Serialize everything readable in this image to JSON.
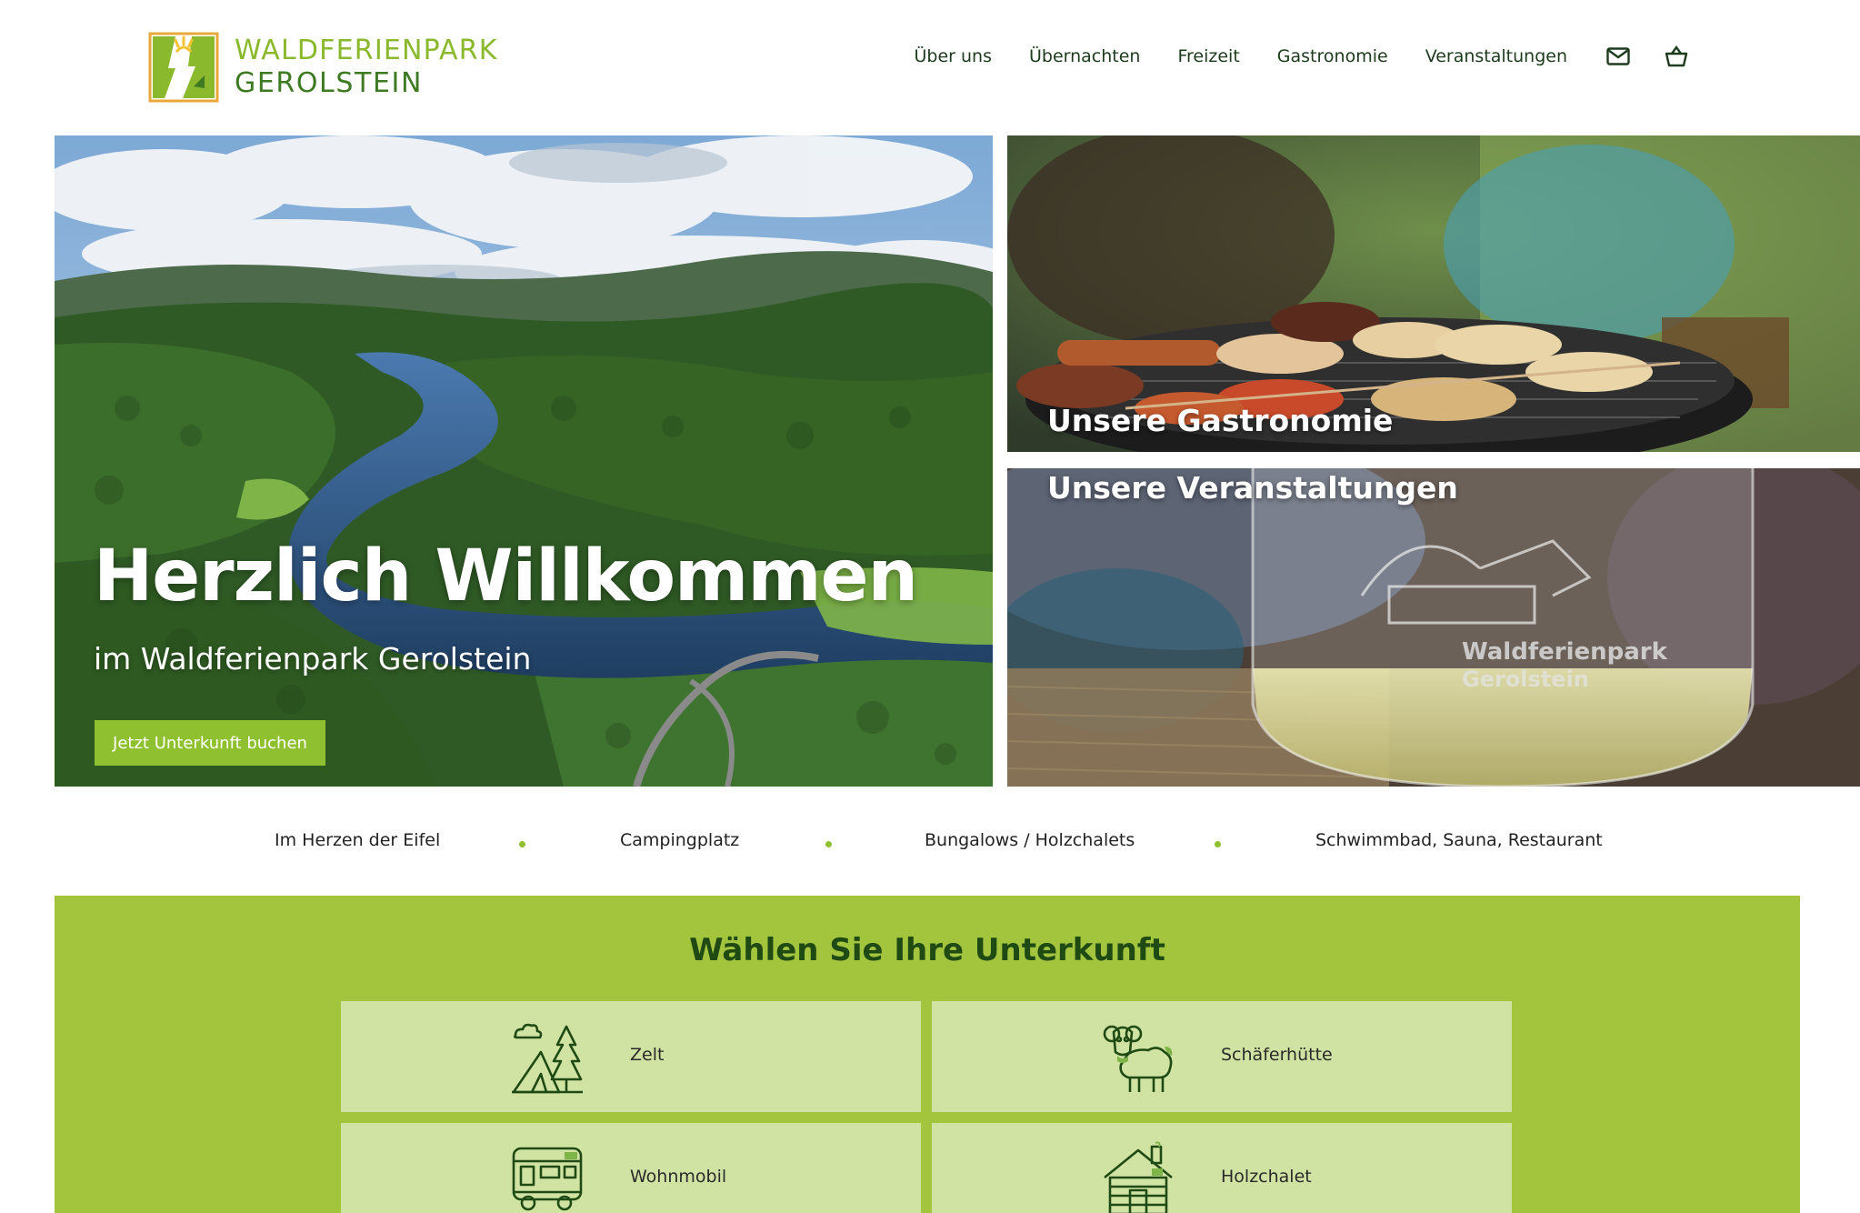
{
  "brand": {
    "name_line1": "WALDFERIENPARK",
    "name_line2": "GEROLSTEIN",
    "accent_color": "#8fc02f",
    "dark_green": "#1f4a14"
  },
  "nav": {
    "items": [
      {
        "label": "Über uns"
      },
      {
        "label": "Übernachten"
      },
      {
        "label": "Freizeit"
      },
      {
        "label": "Gastronomie"
      },
      {
        "label": "Veranstaltungen"
      }
    ],
    "icons": [
      "mail-icon",
      "cart-icon"
    ]
  },
  "hero": {
    "title": "Herzlich Willkommen",
    "subtitle": "im Waldferienpark Gerolstein",
    "cta_label": "Jetzt Unterkunft buchen"
  },
  "tiles": {
    "gastronomy": {
      "title": "Unsere Gastronomie"
    },
    "events": {
      "title": "Unsere Veranstaltungen",
      "glass_text_1": "Waldferienpark",
      "glass_text_2": "Gerolstein"
    }
  },
  "features": [
    "Im Herzen der Eifel",
    "Campingplatz",
    "Bungalows / Holzchalets",
    "Schwimmbad, Sauna, Restaurant"
  ],
  "accommodation": {
    "title": "Wählen Sie Ihre Unterkunft",
    "options": [
      {
        "label": "Zelt",
        "icon": "tent-icon"
      },
      {
        "label": "Schäferhütte",
        "icon": "sheep-icon"
      },
      {
        "label": "Wohnmobil",
        "icon": "motorhome-icon"
      },
      {
        "label": "Holzchalet",
        "icon": "log-cabin-icon"
      }
    ]
  }
}
